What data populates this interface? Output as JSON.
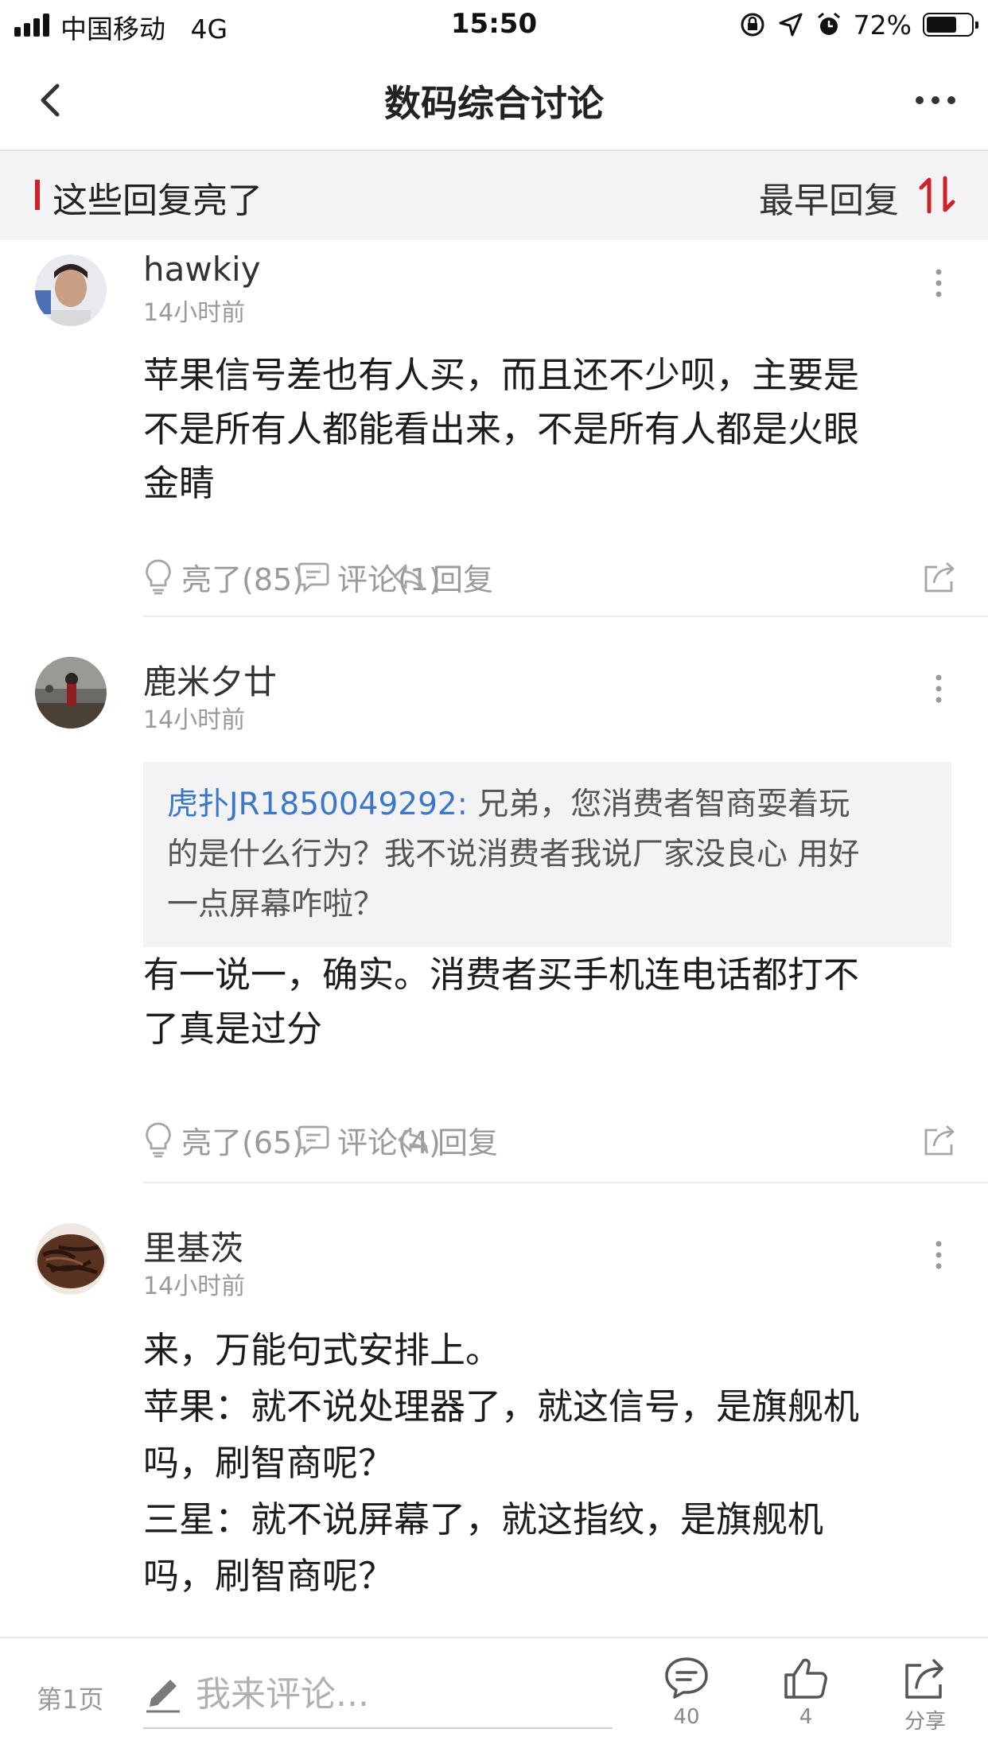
{
  "status_bar": {
    "carrier": "中国移动",
    "network": "4G",
    "time": "15:50",
    "battery_percent": "72%",
    "battery_level": 0.72
  },
  "nav": {
    "title": "数码综合讨论"
  },
  "section": {
    "title": "这些回复亮了",
    "sort_label": "最早回复",
    "accent_color": "#d0212b"
  },
  "posts": [
    {
      "username": "hawkiy",
      "time": "14小时前",
      "body_lines": [
        "苹果信号差也有人买，而且还不少呗，主要是",
        "不是所有人都能看出来，不是所有人都是火眼",
        "金睛"
      ],
      "light_label": "亮了(85)",
      "comment_label": "评论(1)",
      "reply_label": "回复"
    },
    {
      "username": "鹿米夕廿",
      "time": "14小时前",
      "quote": {
        "user": "虎扑JR1850049292:",
        "text_lines": [
          " 兄弟，您消费者智商耍着玩",
          "的是什么行为？我不说消费者我说厂家没良心 用好",
          "一点屏幕咋啦？"
        ]
      },
      "body_lines": [
        "有一说一，确实。消费者买手机连电话都打不",
        "了真是过分"
      ],
      "light_label": "亮了(65)",
      "comment_label": "评论(4)",
      "reply_label": "回复"
    },
    {
      "username": "里基茨",
      "time": "14小时前",
      "body_lines": [
        "来，万能句式安排上。",
        "苹果：就不说处理器了，就这信号，是旗舰机",
        "吗，刷智商呢？",
        "三星：就不说屏幕了，就这指纹，是旗舰机",
        "吗，刷智商呢？"
      ]
    }
  ],
  "bottom_bar": {
    "page_label": "第1页",
    "comment_placeholder": "我来评论...",
    "comments_count": "40",
    "likes_count": "4",
    "share_label": "分享"
  },
  "colors": {
    "link_blue": "#3a77c9",
    "muted_gray": "#9a9a9a"
  }
}
